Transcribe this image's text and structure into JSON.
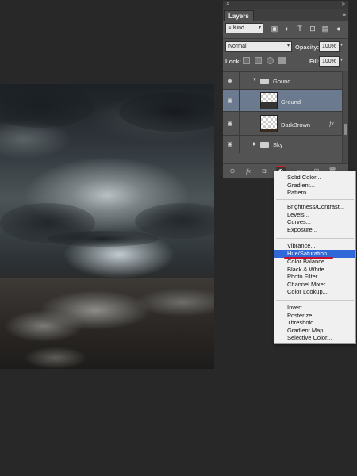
{
  "panel": {
    "tab_label": "Layers",
    "close_glyph": "×",
    "collapse_glyph": "»",
    "menu_glyph": "≡",
    "filter": {
      "label": "Kind",
      "search_glyph": "⌕"
    },
    "blend_mode": "Normal",
    "opacity_label": "Opacity:",
    "opacity_value": "100%",
    "lock_label": "Lock:",
    "fill_label": "Fill:",
    "fill_value": "100%"
  },
  "layers": [
    {
      "name": "Gound",
      "type": "group",
      "expanded": true
    },
    {
      "name": "Ground",
      "type": "layer",
      "selected": true
    },
    {
      "name": "DarkBrown",
      "type": "layer",
      "fx": "fx"
    },
    {
      "name": "Sky",
      "type": "group",
      "expanded": false
    }
  ],
  "bottom_bar": {
    "link_glyph": "⊖",
    "fx_glyph": "fx",
    "mask_glyph": "◘",
    "folder_glyph": "▭",
    "new_glyph": "⊞",
    "trash_glyph": "🗑"
  },
  "adjustment_menu": {
    "group1": [
      "Solid Color...",
      "Gradient...",
      "Pattern..."
    ],
    "group2": [
      "Brightness/Contrast...",
      "Levels...",
      "Curves...",
      "Exposure..."
    ],
    "group3": [
      "Vibrance...",
      "Hue/Saturation...",
      "Color Balance...",
      "Black & White...",
      "Photo Filter...",
      "Channel Mixer...",
      "Color Lookup..."
    ],
    "group4": [
      "Invert",
      "Posterize...",
      "Threshold...",
      "Gradient Map...",
      "Selective Color..."
    ],
    "highlighted": "Hue/Saturation..."
  },
  "colors": {
    "highlight": "#3068d8",
    "annotation": "#c8102e",
    "selected_layer": "#6c7a90"
  }
}
